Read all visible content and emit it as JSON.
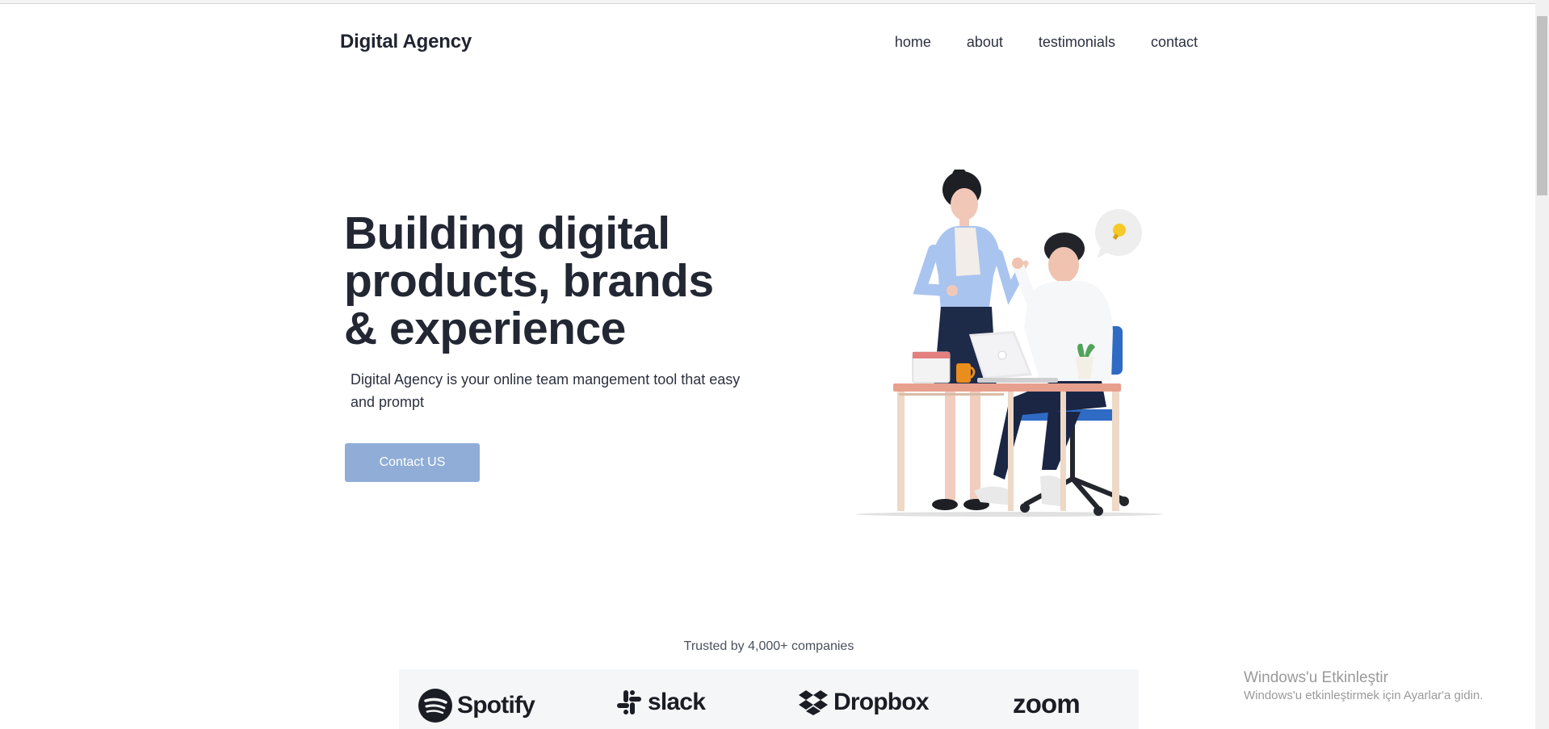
{
  "header": {
    "brand": "Digital Agency",
    "nav": [
      "home",
      "about",
      "testimonials",
      "contact"
    ]
  },
  "hero": {
    "title_lines": [
      "Building digital",
      "products, brands",
      "& experience"
    ],
    "subtitle_lines": [
      "Digital Agency is your online team mangement tool that easy",
      "and prompt"
    ],
    "cta_label": "Contact US"
  },
  "trusted": {
    "text": "Trusted by 4,000+ companies",
    "logos": [
      "Spotify",
      "slack",
      "Dropbox",
      "zoom"
    ]
  },
  "windows_activation": {
    "title": "Windows'u Etkinleştir",
    "subtitle": "Windows'u etkinleştirmek için Ayarlar'a gidin."
  },
  "colors": {
    "cta_background": "#8fadd6",
    "heading_text": "#222733",
    "logo_strip_background": "#f5f6f7"
  }
}
